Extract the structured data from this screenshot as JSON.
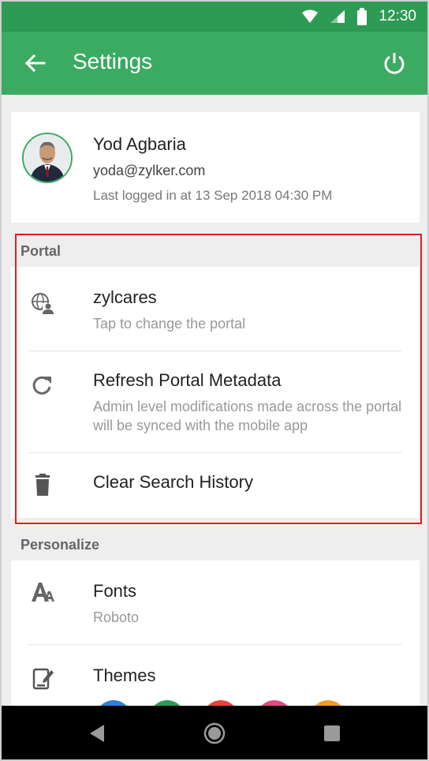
{
  "status_bar": {
    "time": "12:30",
    "icons": [
      "wifi-icon",
      "signal-icon",
      "battery-icon"
    ]
  },
  "app_bar": {
    "title": "Settings",
    "back_icon": "arrow-left-icon",
    "power_icon": "power-icon"
  },
  "profile": {
    "name": "Yod Agbaria",
    "email": "yoda@zylker.com",
    "last_login": "Last logged in at 13 Sep 2018 04:30 PM"
  },
  "portal": {
    "header": "Portal",
    "items": [
      {
        "icon": "globe-user-icon",
        "label": "zylcares",
        "sub": "Tap to change the portal"
      },
      {
        "icon": "refresh-icon",
        "label": "Refresh Portal Metadata",
        "sub": "Admin level modifications made across the portal will be synced with the mobile app"
      },
      {
        "icon": "trash-icon",
        "label": "Clear Search History",
        "sub": ""
      }
    ]
  },
  "personalize": {
    "header": "Personalize",
    "items": [
      {
        "icon": "font-size-icon",
        "label": "Fonts",
        "sub": "Roboto"
      },
      {
        "icon": "theme-edit-icon",
        "label": "Themes"
      }
    ],
    "theme_colors": [
      "#2f7fd8",
      "#2e9b54",
      "#e5453a",
      "#e14a86",
      "#f09a2a"
    ]
  },
  "colors": {
    "accent": "#3aab60",
    "status_bar": "#2e9b54",
    "highlight": "#e02020"
  }
}
